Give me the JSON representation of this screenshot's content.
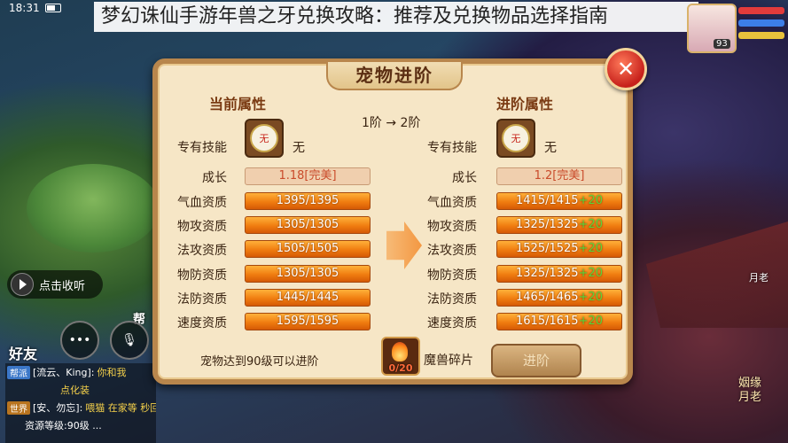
{
  "headline": "梦幻诛仙手游年兽之牙兑换攻略：推荐及兑换物品选择指南",
  "status": {
    "time": "18:31"
  },
  "hud": {
    "level": "93"
  },
  "side": {
    "collapse_label": "点击收听",
    "chat_icon": "chat-bubble-icon",
    "voice_icon": "microphone-icon",
    "friends_label": "好友",
    "help_label": "帮",
    "chat_lines": [
      {
        "tag": "帮派",
        "text": "[流云、King]:",
        "extra": "你和我"
      },
      {
        "tag": "",
        "text": "",
        "extra": "点化装"
      },
      {
        "tag": "世界",
        "text": "[安、勿忘]:",
        "extra": "喂猫 在家等 秒回"
      },
      {
        "tag": "",
        "text": "",
        "extra": "资源等级:90级 ..."
      }
    ],
    "npc_name": "月老",
    "npc_title": "姻缘\n月老"
  },
  "dialog": {
    "title": "宠物进阶",
    "close_icon": "close-x-icon",
    "current_header": "当前属性",
    "advanced_header": "进阶属性",
    "stage_text": "1阶 → 2阶",
    "skill_label": "专有技能",
    "skill_icon_text": "无",
    "skill_value_current": "无",
    "skill_value_advanced": "无",
    "growth_label": "成长",
    "growth_current": "1.18[完美]",
    "growth_advanced": "1.2[完美]",
    "stats": [
      {
        "label": "气血资质",
        "current": "1395/1395",
        "advanced": "1415/1415",
        "bonus": "+20"
      },
      {
        "label": "物攻资质",
        "current": "1305/1305",
        "advanced": "1325/1325",
        "bonus": "+20"
      },
      {
        "label": "法攻资质",
        "current": "1505/1505",
        "advanced": "1525/1525",
        "bonus": "+20"
      },
      {
        "label": "物防资质",
        "current": "1305/1305",
        "advanced": "1325/1325",
        "bonus": "+20"
      },
      {
        "label": "法防资质",
        "current": "1445/1445",
        "advanced": "1465/1465",
        "bonus": "+20"
      },
      {
        "label": "速度资质",
        "current": "1595/1595",
        "advanced": "1615/1615",
        "bonus": "+20"
      }
    ],
    "footer_note": "宠物达到90级可以进阶",
    "material_icon": "beast-shard-icon",
    "material_count": "0/20",
    "material_name": "魔兽碎片",
    "advance_button": "进阶"
  }
}
